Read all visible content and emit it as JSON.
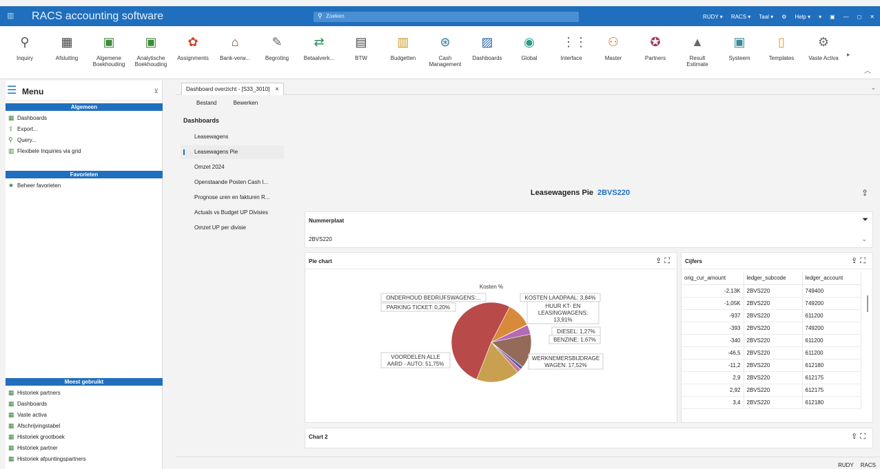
{
  "app": {
    "title": "RACS accounting software",
    "search_placeholder": "Zoeken",
    "top_menu": [
      "RUDY ▾",
      "RACS ▾",
      "Taal ▾",
      "⚙",
      "Help ▾",
      "▾",
      "▣",
      "—",
      "◻",
      "✕"
    ]
  },
  "ribbon": {
    "items": [
      {
        "label": "Inquiry",
        "icon": "⚲",
        "color": "#555555"
      },
      {
        "label": "Afsluiting",
        "icon": "▦",
        "color": "#444444"
      },
      {
        "label": "Algemene Boekhouding",
        "icon": "▣",
        "color": "#3c8a3c"
      },
      {
        "label": "Analytische Boekhouding",
        "icon": "▣",
        "color": "#3c8a3c"
      },
      {
        "label": "Assignments",
        "icon": "✿",
        "color": "#c94a2a"
      },
      {
        "label": "Bank-verw...",
        "icon": "⌂",
        "color": "#7a4a2a"
      },
      {
        "label": "Begroting",
        "icon": "✎",
        "color": "#666666"
      },
      {
        "label": "Betaalverk...",
        "icon": "⇄",
        "color": "#2a8a5a"
      },
      {
        "label": "BTW",
        "icon": "▤",
        "color": "#444444"
      },
      {
        "label": "Budgetten",
        "icon": "▥",
        "color": "#c99a2a"
      },
      {
        "label": "Cash Management",
        "icon": "⊛",
        "color": "#2a7a9a"
      },
      {
        "label": "Dashboards",
        "icon": "▨",
        "color": "#3a6ab0"
      },
      {
        "label": "Global",
        "icon": "◉",
        "color": "#2a9a8a"
      },
      {
        "label": "Interface",
        "icon": "⋮⋮",
        "color": "#555555"
      },
      {
        "label": "Master",
        "icon": "⚇",
        "color": "#c97a2a"
      },
      {
        "label": "Partners",
        "icon": "✪",
        "color": "#a03a5a"
      },
      {
        "label": "Result Estimate",
        "icon": "▲",
        "color": "#6a6a6a"
      },
      {
        "label": "Systeem",
        "icon": "▣",
        "color": "#3a8a9a"
      },
      {
        "label": "Templates",
        "icon": "▯",
        "color": "#e0a020"
      },
      {
        "label": "Vaste Activa",
        "icon": "⚙",
        "color": "#6a6a6a"
      }
    ]
  },
  "sidebar": {
    "title": "Menu",
    "algemeen_title": "Algemeen",
    "algemeen": [
      "Dashboards",
      "Export...",
      "Query...",
      "Flexibele Inquiries via grid"
    ],
    "favorieten_title": "Favorieten",
    "favorieten": [
      "Beheer favorieten"
    ],
    "meest_title": "Meest gebruikt",
    "meest": [
      "Historiek partners",
      "Dashboards",
      "Vaste activa",
      "Afschrijvingstabel",
      "Historiek grootboek",
      "Historiek partner",
      "Historiek afpuntingspartners"
    ]
  },
  "tab": {
    "label": "Dashboard overzicht - [S33_3010]",
    "close": "×"
  },
  "menubar": {
    "bestand": "Bestand",
    "bewerken": "Bewerken"
  },
  "dashboards": {
    "title": "Dashboards",
    "items": [
      "Leasewagens",
      "Leasewagens Pie",
      "Omzet 2024",
      "Openstaande Posten Cash I...",
      "Prognose uren en fakturen R...",
      "Actuals vs Budget UP Divisies",
      "Omzet UP per divisie"
    ],
    "active_index": 1
  },
  "main": {
    "title": "Leasewagens Pie",
    "plate": "2BVS220",
    "filter_label": "Nummerplaat",
    "filter_value": "2BVS220",
    "pie_panel_title": "Pie chart",
    "table_panel_title": "Cijfers",
    "chart2_title": "Chart 2"
  },
  "chart_data": {
    "type": "pie",
    "title": "Kosten %",
    "slices": [
      {
        "label": "VOORDELEN ALLE AARD - AUTO",
        "value": 51.75,
        "display": "VOORDELEN ALLE AARD - AUTO: 51,75%",
        "color": "#b94a4a"
      },
      {
        "label": "ONDERHOUD BEDRIJFSWAGENS",
        "value": 10.14,
        "display": "ONDERHOUD BEDRIJFSWAGENS:...",
        "color": "#d88a3a"
      },
      {
        "label": "PARKING TICKET",
        "value": 0.2,
        "display": "PARKING TICKET: 0,20%",
        "color": "#6a8ac9"
      },
      {
        "label": "KOSTEN LAADPAAL",
        "value": 3.84,
        "display": "KOSTEN LAADPAAL: 3,84%",
        "color": "#b46ab4"
      },
      {
        "label": "HUUR KT- EN LEASINGWAGENS",
        "value": 13.91,
        "display": "HUUR KT- EN LEASINGWAGENS: 13,91%",
        "color": "#946a5a"
      },
      {
        "label": "DIESEL",
        "value": 1.27,
        "display": "DIESEL: 1,27%",
        "color": "#5a5aa9"
      },
      {
        "label": "BENZINE",
        "value": 1.67,
        "display": "BENZINE: 1,67%",
        "color": "#c97a8a"
      },
      {
        "label": "WERKNEMERSBIJDRAGE WAGEN",
        "value": 17.52,
        "display": "WERKNEMERSBIJDRAGE WAGEN: 17,52%",
        "color": "#c9a050"
      }
    ]
  },
  "table": {
    "columns": [
      "orig_cur_amount",
      "ledger_subcode",
      "ledger_account"
    ],
    "rows": [
      [
        "-2,13K",
        "2BVS220",
        "749400"
      ],
      [
        "-1,05K",
        "2BVS220",
        "749200"
      ],
      [
        "-937",
        "2BVS220",
        "611200"
      ],
      [
        "-393",
        "2BVS220",
        "749200"
      ],
      [
        "-340",
        "2BVS220",
        "611200"
      ],
      [
        "-46,5",
        "2BVS220",
        "611200"
      ],
      [
        "-11,2",
        "2BVS220",
        "612180"
      ],
      [
        "2,9",
        "2BVS220",
        "612175"
      ],
      [
        "2,92",
        "2BVS220",
        "612175"
      ],
      [
        "3,4",
        "2BVS220",
        "612180"
      ]
    ]
  },
  "status": {
    "user": "RUDY",
    "company": "RACS"
  }
}
